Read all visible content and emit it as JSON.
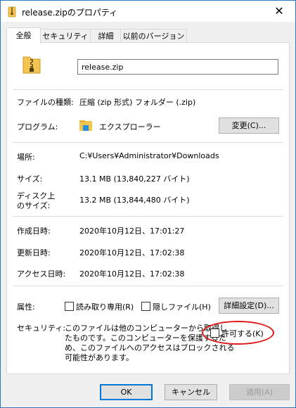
{
  "window": {
    "title": "release.zipのプロパティ",
    "close_label": "✕"
  },
  "tabs": [
    {
      "label": "全般",
      "active": true
    },
    {
      "label": "セキュリティ",
      "active": false
    },
    {
      "label": "詳細",
      "active": false
    },
    {
      "label": "以前のバージョン",
      "active": false
    }
  ],
  "general": {
    "file_name": "release.zip",
    "file_type_label": "ファイルの種類:",
    "file_type_value": "圧縮 (zip 形式) フォルダー (.zip)",
    "program_label": "プログラム:",
    "program_value": "エクスプローラー",
    "change_button": "変更(C)...",
    "location_label": "場所:",
    "location_value": "C:¥Users¥Administrator¥Downloads",
    "size_label": "サイズ:",
    "size_value": "13.1 MB (13,840,227 バイト)",
    "disk_size_label_line1": "ディスク上",
    "disk_size_label_line2": "のサイズ:",
    "disk_size_value": "13.2 MB (13,844,480 バイト)",
    "created_label": "作成日時:",
    "created_value": "2020年10月12日、17:01:27",
    "modified_label": "更新日時:",
    "modified_value": "2020年10月12日、17:02:38",
    "accessed_label": "アクセス日時:",
    "accessed_value": "2020年10月12日、17:02:38",
    "attributes_label": "属性:",
    "readonly_label": "読み取り専用(R)",
    "hidden_label": "隠しファイル(H)",
    "advanced_button": "詳細設定(D)...",
    "security_label": "セキュリティ:",
    "security_text_line1": "このファイルは他のコンピューターから取得し",
    "security_text_line2": "たものです。このコンピューターを保護するた",
    "security_text_line3": "め、このファイルへのアクセスはブロックされる",
    "security_text_line4": "可能性があります。",
    "unblock_label": "許可する(K)"
  },
  "footer": {
    "ok": "OK",
    "cancel": "キャンセル",
    "apply": "適用(A)"
  },
  "colors": {
    "accent": "#0078d7",
    "highlight_ellipse": "#e0191b",
    "zip_folder": "#f3c44f"
  },
  "icons": {
    "title": "zip-folder-icon",
    "file": "zip-folder-icon",
    "program": "file-explorer-icon",
    "close": "close-icon"
  }
}
